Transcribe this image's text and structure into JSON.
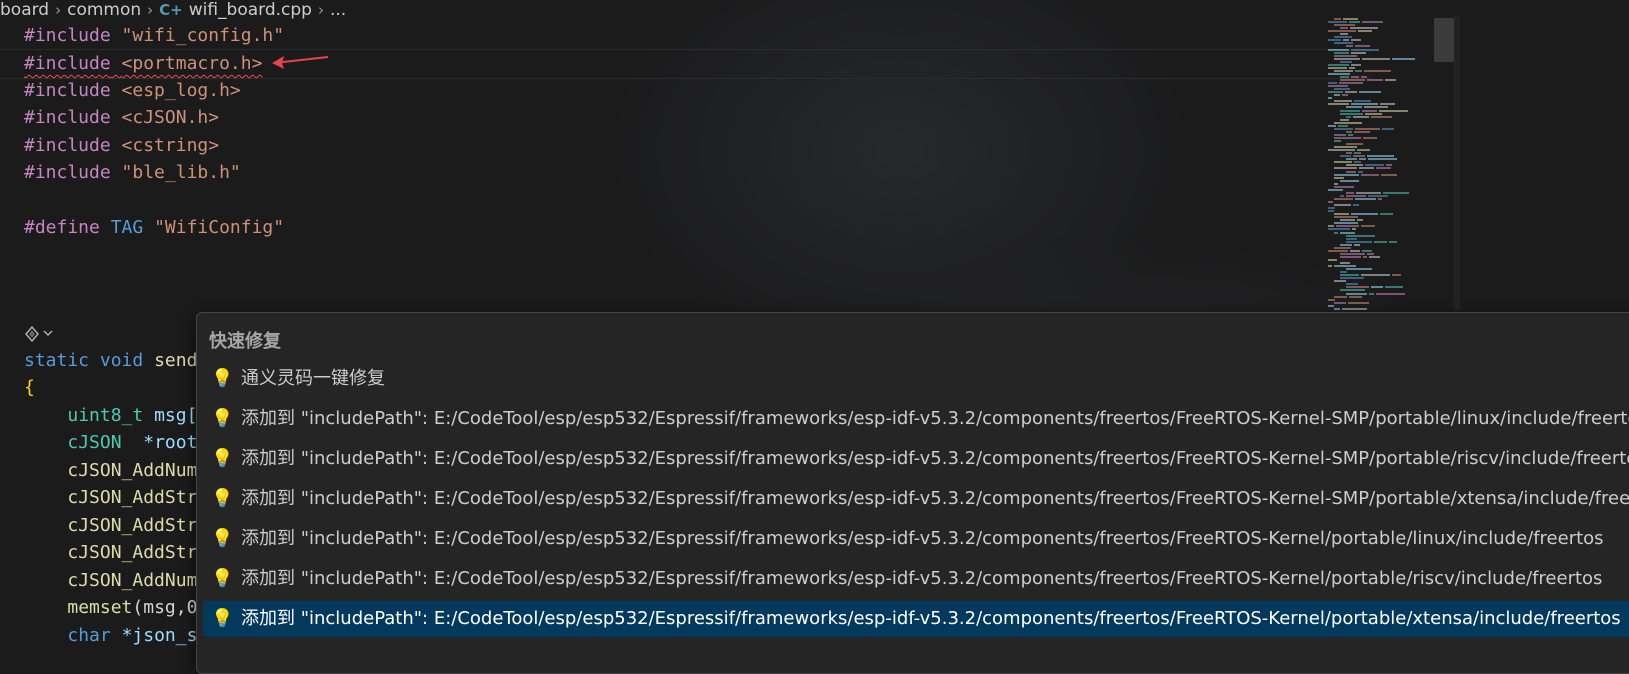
{
  "breadcrumb": {
    "items": [
      "board",
      "common",
      "wifi_board.cpp",
      "..."
    ],
    "file_icon": "cpp-file-icon"
  },
  "code": {
    "lines": [
      {
        "directive": "#include",
        "arg": "\"wifi_config.h\""
      },
      {
        "directive": "#include",
        "arg": "<portmacro.h>"
      },
      {
        "directive": "#include",
        "arg": "<esp_log.h>"
      },
      {
        "directive": "#include",
        "arg": "<cJSON.h>"
      },
      {
        "directive": "#include",
        "arg": "<cstring>"
      },
      {
        "directive": "#include",
        "arg": "\"ble_lib.h\""
      },
      {
        "directive": "#define",
        "name": "TAG",
        "arg": "\"WifiConfig\""
      },
      {
        "kw1": "static",
        "kw2": "void",
        "fn": "send"
      },
      {
        "text": "{"
      },
      {
        "type": "uint8_t",
        "rest": "msg["
      },
      {
        "type": "cJSON",
        "rest": "*root"
      },
      {
        "fn": "cJSON_AddNum"
      },
      {
        "fn": "cJSON_AddStr"
      },
      {
        "fn": "cJSON_AddStr"
      },
      {
        "fn": "cJSON_AddStr"
      },
      {
        "fn": "cJSON_AddNum"
      },
      {
        "fn": "memset",
        "rest": "(msg,0"
      },
      {
        "kw1": "char",
        "rest": "*json_s"
      }
    ]
  },
  "quick_fix": {
    "title": "快速修复",
    "items": [
      "通义灵码一键修复",
      "添加到 \"includePath\": E:/CodeTool/esp/esp532/Espressif/frameworks/esp-idf-v5.3.2/components/freertos/FreeRTOS-Kernel-SMP/portable/linux/include/freertos",
      "添加到 \"includePath\": E:/CodeTool/esp/esp532/Espressif/frameworks/esp-idf-v5.3.2/components/freertos/FreeRTOS-Kernel-SMP/portable/riscv/include/freertos",
      "添加到 \"includePath\": E:/CodeTool/esp/esp532/Espressif/frameworks/esp-idf-v5.3.2/components/freertos/FreeRTOS-Kernel-SMP/portable/xtensa/include/freertos",
      "添加到 \"includePath\": E:/CodeTool/esp/esp532/Espressif/frameworks/esp-idf-v5.3.2/components/freertos/FreeRTOS-Kernel/portable/linux/include/freertos",
      "添加到 \"includePath\": E:/CodeTool/esp/esp532/Espressif/frameworks/esp-idf-v5.3.2/components/freertos/FreeRTOS-Kernel/portable/riscv/include/freertos",
      "添加到 \"includePath\": E:/CodeTool/esp/esp532/Espressif/frameworks/esp-idf-v5.3.2/components/freertos/FreeRTOS-Kernel/portable/xtensa/include/freertos"
    ],
    "selected_index": 6,
    "item_icon": "lightbulb-icon"
  },
  "colors": {
    "background": "#1b1b1c",
    "directive": "#c586c0",
    "string": "#ce9178",
    "keyword": "#569cd6",
    "function": "#dcdcaa",
    "type": "#4ec9b0",
    "error_squiggle": "#f14c4c",
    "selection": "#04395e",
    "lightbulb": "#ffcc00"
  }
}
